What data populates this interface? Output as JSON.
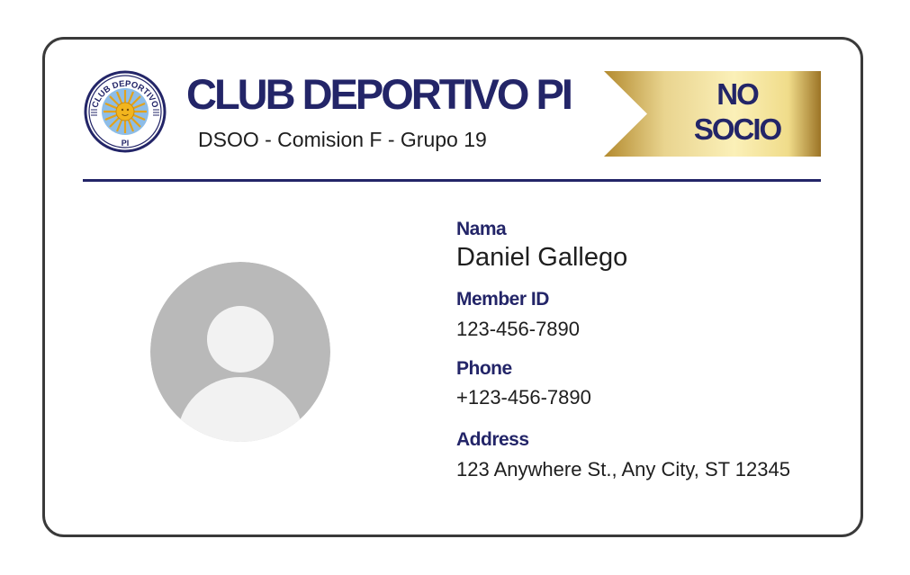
{
  "club": {
    "title": "CLUB DEPORTIVO PI",
    "subtitle": "DSOO - Comision F - Grupo 19",
    "logo": {
      "ring_text": "CLUB DEPORTIVO",
      "bottom_text": "PI",
      "icon": "sun-emblem-icon"
    }
  },
  "status_banner": {
    "line1": "NO",
    "line2": "SOCIO"
  },
  "member": {
    "name_label": "Nama",
    "name_value": "Daniel Gallego",
    "id_label": "Member ID",
    "id_value": "123-456-7890",
    "phone_label": "Phone",
    "phone_value": "+123-456-7890",
    "address_label": "Address",
    "address_value": "123 Anywhere St., Any City, ST 12345"
  },
  "avatar": {
    "icon": "user-placeholder-icon"
  },
  "colors": {
    "brand_navy": "#232568",
    "gold_light": "#f7e9a6",
    "gold_dark": "#b38a2e",
    "card_border": "#3a3a3a",
    "avatar_gray": "#b9b9b9"
  }
}
